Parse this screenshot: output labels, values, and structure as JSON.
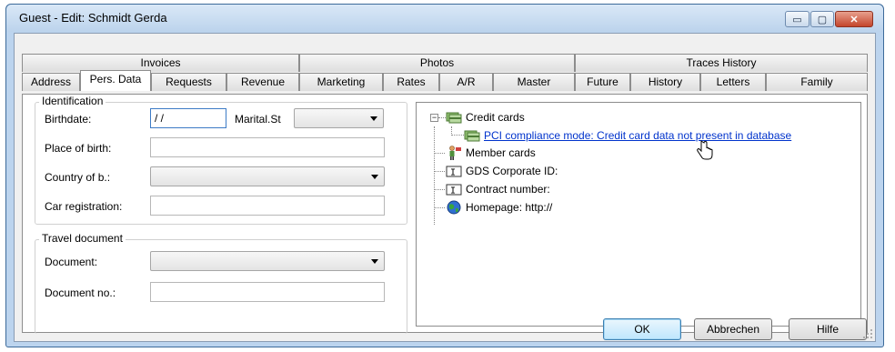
{
  "window": {
    "title": "Guest - Edit: Schmidt Gerda",
    "minimize": "▭",
    "maximize": "▢",
    "close": "✕"
  },
  "tabs_top": [
    "Invoices",
    "Photos",
    "Traces History"
  ],
  "tabs_bottom": [
    "Address",
    "Pers. Data",
    "Requests",
    "Revenue",
    "Marketing",
    "Rates",
    "A/R",
    "Master",
    "Future",
    "History",
    "Letters",
    "Family"
  ],
  "active_tab": "Pers. Data",
  "identification": {
    "legend": "Identification",
    "birthdate_label": "Birthdate:",
    "birthdate_value": "/ /",
    "marital_label": "Marital.St",
    "marital_value": "",
    "place_label": "Place of birth:",
    "place_value": "",
    "country_label": "Country of b.:",
    "country_value": "",
    "car_label": "Car registration:",
    "car_value": ""
  },
  "travel": {
    "legend": "Travel document",
    "document_label": "Document:",
    "document_value": "",
    "docno_label": "Document no.:",
    "docno_value": ""
  },
  "tree": {
    "credit_cards": "Credit cards",
    "pci_notice": "PCI compliance mode: Credit card data not present in database",
    "member_cards": "Member cards",
    "gds": "GDS Corporate ID:",
    "contract": "Contract number:",
    "homepage": "Homepage: http://",
    "expander": "−"
  },
  "buttons": {
    "ok": "OK",
    "cancel": "Abbrechen",
    "help": "Hilfe"
  }
}
